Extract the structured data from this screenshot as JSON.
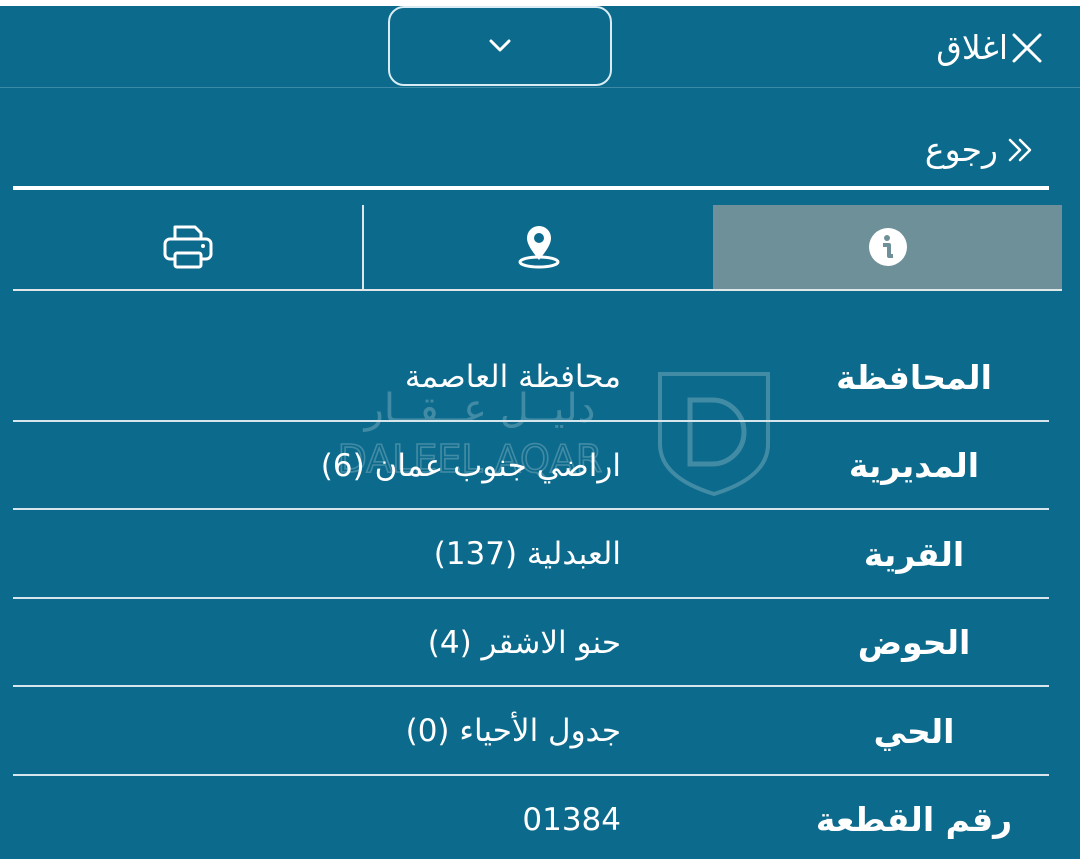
{
  "header": {
    "close_label": "اغلاق",
    "close_icon": "close-icon",
    "collapse_icon": "chevron-down-icon"
  },
  "nav": {
    "back_label": "رجوع",
    "back_icon": "double-chevron-right-icon"
  },
  "tabs": [
    {
      "id": "info",
      "icon": "info-circle-icon",
      "active": true
    },
    {
      "id": "location",
      "icon": "map-pin-icon",
      "active": false
    },
    {
      "id": "print",
      "icon": "printer-icon",
      "active": false
    }
  ],
  "details": [
    {
      "label": "المحافظة",
      "value": "محافظة العاصمة"
    },
    {
      "label": "المديرية",
      "value": "اراضي جنوب عمان (6)"
    },
    {
      "label": "القرية",
      "value": "العبدلية (137)"
    },
    {
      "label": "الحوض",
      "value": "حنو الاشقر (4)"
    },
    {
      "label": "الحي",
      "value": "جدول الأحياء (0)"
    },
    {
      "label": "رقم القطعة",
      "value": "01384"
    }
  ],
  "watermark": {
    "arabic_text": "دليــل عــقــار",
    "latin_text": "DALEEL AQAR"
  },
  "colors": {
    "background": "#0c6a8c",
    "active_tab": "#6e9199",
    "foreground": "#ffffff"
  }
}
